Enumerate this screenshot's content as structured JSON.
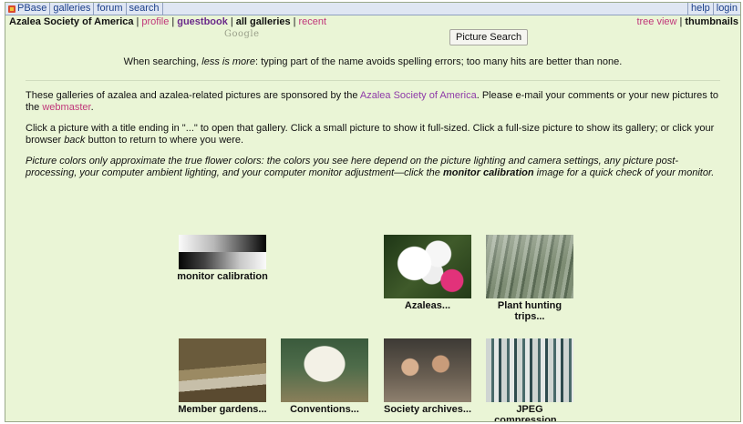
{
  "topnav": {
    "left": [
      "PBase",
      "galleries",
      "forum",
      "search"
    ],
    "right": [
      "help",
      "login"
    ]
  },
  "subnav": {
    "site": "Azalea Society of America",
    "profile": "profile",
    "guestbook": "guestbook",
    "all_galleries": "all galleries",
    "recent": "recent",
    "tree_view": "tree view",
    "thumbnails": "thumbnails"
  },
  "search": {
    "placeholder": "Google",
    "button": "Picture Search",
    "hint_pre": "When searching, ",
    "hint_em": "less is more",
    "hint_post": ": typing part of the name avoids spelling errors; too many hits are better than none."
  },
  "intro": {
    "p1_pre": "These galleries of azalea and azalea-related pictures are sponsored by the ",
    "p1_link": "Azalea Society of America",
    "p1_mid": ". Please e-mail your comments or your new pictures to the ",
    "p1_link2": "webmaster",
    "p1_end": ".",
    "p2_a": "Click a picture with a title ending in \"...\" to open that gallery. Click a small picture to show it full-sized. Click a full-size picture to show its gallery; or click your browser ",
    "p2_em": "back",
    "p2_b": " button to return to where you were.",
    "p3_a": "Picture colors only approximate the true flower colors: the colors you see here depend on the picture lighting and camera settings, any picture post-processing, your computer ambient lighting, and your computer monitor adjustment—click the ",
    "p3_bold": "monitor calibration",
    "p3_b": " image for a quick check of your monitor."
  },
  "galleries": [
    {
      "caption": "monitor calibration",
      "image": "calibration-gradient"
    },
    {
      "caption": "Azaleas...",
      "image": "azalea-flowers"
    },
    {
      "caption": "Plant hunting trips...",
      "image": "misty-forest"
    },
    {
      "caption": "Member gardens...",
      "image": "garden-path"
    },
    {
      "caption": "Conventions...",
      "image": "people-group"
    },
    {
      "caption": "Society archives...",
      "image": "people-at-table"
    },
    {
      "caption": "JPEG compression...",
      "image": "striped-sample"
    }
  ],
  "colors": {
    "background": "#eaf5d6",
    "link_pink": "#c0367a",
    "nav_blue": "#1b3f8a"
  }
}
